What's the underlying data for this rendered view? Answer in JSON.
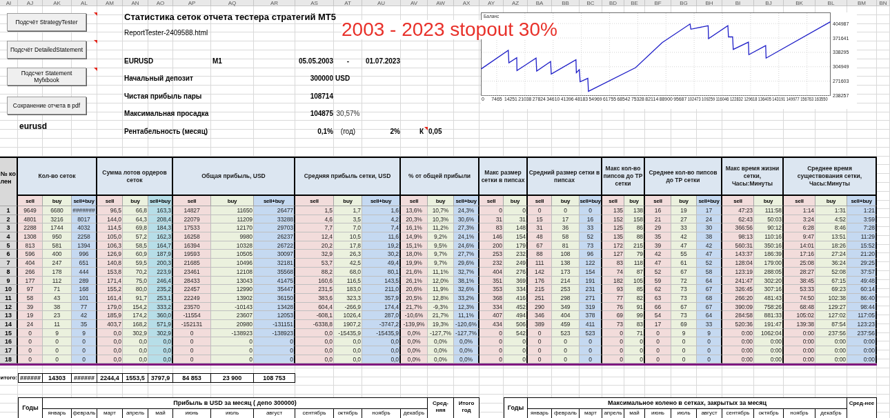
{
  "column_headers": [
    "AI",
    "AJ",
    "AK",
    "AL",
    "AM",
    "AN",
    "AO",
    "AP",
    "AQ",
    "AR",
    "AS",
    "AT",
    "AU",
    "AV",
    "AW",
    "AX",
    "AY",
    "AZ",
    "BA",
    "BB",
    "BC",
    "BD",
    "BE",
    "BF",
    "BG",
    "BH",
    "BI",
    "BJ",
    "BK",
    "BL",
    "BM",
    "BN"
  ],
  "macro_buttons": [
    {
      "label": "Подсчёт StrategyTester",
      "comment": true
    },
    {
      "label": "Подсчёт DetailedStatement",
      "comment": true
    },
    {
      "label": "Подсчет Statement Myfxbook",
      "comment": true
    },
    {
      "label": "Сохранение отчета в pdf",
      "comment": false
    }
  ],
  "sheet_label": "eurusd",
  "report": {
    "title": "Статистика сеток отчета тестера стратегий МТ5",
    "file": "ReportTester-2409588.html",
    "note": "2003 - 2023 stopout 30%"
  },
  "summary": {
    "symbol": "EURUSD",
    "timeframe": "M1",
    "date_from": "05.05.2003",
    "date_separator": "-",
    "date_to": "01.07.2023",
    "rows": [
      {
        "label": "Начальный депозит",
        "value": "300000",
        "unit": "USD"
      },
      {
        "label": "Чистая прибыль пары",
        "value": "108714"
      },
      {
        "label": "Максимальная просадка",
        "value": "104875",
        "percent": "30,57%"
      },
      {
        "label": "Рентабельность (месяц)",
        "value": "0,1%",
        "period_label": "(год)",
        "yearly_value": "2%",
        "ratio_label": "К",
        "ratio_value": "0,05",
        "ratio_comment": true
      }
    ]
  },
  "chart": {
    "chart_data": {
      "type": "line",
      "x": [
        0,
        13000,
        13300,
        17100,
        17200,
        26400,
        26700,
        33400,
        33700,
        45600,
        45800,
        47200,
        47600,
        51300,
        51600,
        74300,
        87100,
        100500,
        100900,
        109200,
        109400,
        118700,
        119000,
        121000,
        121300,
        128600,
        128800,
        136900,
        137100,
        168000
      ],
      "series": [
        {
          "name": "Баланс",
          "color": "#1f1fc8",
          "values": [
            300000,
            343000,
            314000,
            326000,
            296000,
            325000,
            295000,
            317000,
            288000,
            321000,
            291000,
            298000,
            270000,
            278000,
            248000,
            303000,
            361000,
            404000,
            392000,
            400000,
            370000,
            400000,
            374000,
            374000,
            345000,
            362000,
            333000,
            354000,
            325000,
            409000
          ]
        }
      ],
      "xlim": [
        0,
        168000
      ],
      "ylim": [
        238257,
        430000
      ],
      "xticks": [
        0,
        7465,
        14251,
        21038,
        27824,
        34610,
        41396,
        48183,
        54969,
        61755,
        68542,
        75328,
        82114,
        88900,
        95687,
        102473,
        109259,
        116046,
        122832,
        129618,
        136405,
        143191,
        149977,
        156763,
        163550
      ],
      "yticks": [
        238257,
        271603,
        304949,
        338295,
        371641,
        404987
      ],
      "grid": true
    }
  },
  "table": {
    "row_number_heading": "№ колен",
    "groups": [
      {
        "title": "Кол-во сеток",
        "columns": [
          {
            "label": "sell",
            "color": "#f2dcdb"
          },
          {
            "label": "buy",
            "color": "#ebf1de"
          },
          {
            "label": "sell+buy",
            "color": "#c5d9f1"
          }
        ]
      },
      {
        "title": "Сумма лотов ордеров сеток",
        "columns": [
          {
            "label": "sell",
            "color": "#f2dcdb"
          },
          {
            "label": "buy",
            "color": "#ebf1de"
          },
          {
            "label": "sell+buy",
            "color": "#b7dee8"
          }
        ]
      },
      {
        "title": "Общая прибыль, USD",
        "columns": [
          {
            "label": "sell",
            "color": "#f2dcdb"
          },
          {
            "label": "buy",
            "color": "#ebf1de"
          },
          {
            "label": "sell+buy",
            "color": "#c5d9f1"
          }
        ]
      },
      {
        "title": "Средняя прибыль сетки, USD",
        "columns": [
          {
            "label": "sell",
            "color": "#f2dcdb"
          },
          {
            "label": "buy",
            "color": "#ebf1de"
          },
          {
            "label": "sell+buy",
            "color": "#c5d9f1"
          }
        ]
      },
      {
        "title": "% от общей прибыли",
        "columns": [
          {
            "label": "sell",
            "color": "#f2dcdb"
          },
          {
            "label": "buy",
            "color": "#ebf1de"
          },
          {
            "label": "sell+buy",
            "color": "#c5d9f1"
          }
        ]
      },
      {
        "title": "Макс размер сетки в пипсах",
        "columns": [
          {
            "label": "sell",
            "color": "#f2dcdb"
          },
          {
            "label": "buy",
            "color": "#ebf1de"
          }
        ]
      },
      {
        "title": "Средний размер сетки в пипсах",
        "columns": [
          {
            "label": "sell",
            "color": "#f2dcdb"
          },
          {
            "label": "buy",
            "color": "#ebf1de"
          },
          {
            "label": "sell+buy",
            "color": "#c5d9f1"
          }
        ]
      },
      {
        "title": "Макс кол-во пипсов до ТР сетки",
        "columns": [
          {
            "label": "sell",
            "color": "#f2dcdb"
          },
          {
            "label": "buy",
            "color": "#ebf1de"
          }
        ]
      },
      {
        "title": "Среднее кол-во пипсов до ТР сетки",
        "columns": [
          {
            "label": "sell",
            "color": "#f2dcdb"
          },
          {
            "label": "buy",
            "color": "#ebf1de"
          },
          {
            "label": "sell+buy",
            "color": "#c5d9f1"
          }
        ]
      },
      {
        "title": "Макс время жизни сетки, Часы:Минуты",
        "columns": [
          {
            "label": "sell",
            "color": "#f2dcdb"
          },
          {
            "label": "buy",
            "color": "#ebf1de"
          }
        ]
      },
      {
        "title": "Среднее время существования сетки, Часы:Минуты",
        "columns": [
          {
            "label": "sell",
            "color": "#f2dcdb"
          },
          {
            "label": "buy",
            "color": "#ebf1de"
          },
          {
            "label": "sell+buy",
            "color": "#c5d9f1"
          }
        ]
      }
    ],
    "rows": [
      {
        "number": "1",
        "cells": [
          "9649",
          "6680",
          "#######",
          "96,5",
          "66,8",
          "163,3",
          "14827",
          "11650",
          "26477",
          "1,5",
          "1,7",
          "1,6",
          "13,6%",
          "10,7%",
          "24,3%",
          "0",
          "0",
          "0",
          "0",
          "0",
          "135",
          "138",
          "16",
          "19",
          "17",
          "47:23",
          "111:58",
          "1:14",
          "1:31",
          "1:21"
        ]
      },
      {
        "number": "2",
        "cells": [
          "4801",
          "3216",
          "8017",
          "144,0",
          "64,3",
          "208,4",
          "22079",
          "11209",
          "33288",
          "4,6",
          "3,5",
          "4,2",
          "20,3%",
          "10,3%",
          "30,6%",
          "31",
          "31",
          "15",
          "17",
          "16",
          "152",
          "158",
          "21",
          "27",
          "24",
          "62:43",
          "50:03",
          "3:24",
          "4:52",
          "3:59"
        ]
      },
      {
        "number": "3",
        "cells": [
          "2288",
          "1744",
          "4032",
          "114,5",
          "69,8",
          "184,3",
          "17533",
          "12170",
          "29703",
          "7,7",
          "7,0",
          "7,4",
          "16,1%",
          "11,2%",
          "27,3%",
          "83",
          "148",
          "31",
          "36",
          "33",
          "125",
          "86",
          "29",
          "33",
          "30",
          "366:56",
          "90:12",
          "6:28",
          "8:46",
          "7:28"
        ]
      },
      {
        "number": "4",
        "cells": [
          "1308",
          "950",
          "2258",
          "105,0",
          "57,2",
          "162,3",
          "16258",
          "9980",
          "26237",
          "12,4",
          "10,5",
          "11,6",
          "14,9%",
          "9,2%",
          "24,1%",
          "146",
          "154",
          "48",
          "58",
          "52",
          "135",
          "88",
          "35",
          "42",
          "38",
          "98:13",
          "110:16",
          "9:47",
          "13:51",
          "11:29"
        ]
      },
      {
        "number": "5",
        "cells": [
          "813",
          "581",
          "1394",
          "106,3",
          "58,5",
          "164,7",
          "16394",
          "10328",
          "26722",
          "20,2",
          "17,8",
          "19,2",
          "15,1%",
          "9,5%",
          "24,6%",
          "200",
          "179",
          "67",
          "81",
          "73",
          "172",
          "215",
          "39",
          "47",
          "42",
          "560:31",
          "350:16",
          "14:01",
          "18:26",
          "15:52"
        ]
      },
      {
        "number": "6",
        "cells": [
          "596",
          "400",
          "996",
          "126,9",
          "60,9",
          "187,9",
          "19593",
          "10505",
          "30097",
          "32,9",
          "26,3",
          "30,2",
          "18,0%",
          "9,7%",
          "27,7%",
          "253",
          "232",
          "88",
          "108",
          "96",
          "127",
          "79",
          "42",
          "55",
          "47",
          "143:37",
          "186:39",
          "17:16",
          "27:24",
          "21:20"
        ]
      },
      {
        "number": "7",
        "cells": [
          "404",
          "247",
          "651",
          "140,8",
          "59,5",
          "200,3",
          "21685",
          "10496",
          "32181",
          "53,7",
          "42,5",
          "49,4",
          "19,9%",
          "9,7%",
          "29,6%",
          "232",
          "249",
          "111",
          "138",
          "122",
          "83",
          "118",
          "47",
          "61",
          "52",
          "128:04",
          "179:00",
          "25:08",
          "36:24",
          "29:25"
        ]
      },
      {
        "number": "8",
        "cells": [
          "266",
          "178",
          "444",
          "153,8",
          "70,2",
          "223,9",
          "23461",
          "12108",
          "35568",
          "88,2",
          "68,0",
          "80,1",
          "21,6%",
          "11,1%",
          "32,7%",
          "404",
          "276",
          "142",
          "173",
          "154",
          "74",
          "87",
          "52",
          "67",
          "58",
          "123:19",
          "288:05",
          "28:27",
          "52:08",
          "37:57"
        ]
      },
      {
        "number": "9",
        "cells": [
          "177",
          "112",
          "289",
          "171,4",
          "75,0",
          "246,4",
          "28433",
          "13043",
          "41475",
          "160,6",
          "116,5",
          "143,5",
          "26,1%",
          "12,0%",
          "38,1%",
          "351",
          "369",
          "176",
          "214",
          "191",
          "182",
          "105",
          "59",
          "72",
          "64",
          "241:47",
          "302:20",
          "38:45",
          "67:15",
          "49:48"
        ]
      },
      {
        "number": "10",
        "cells": [
          "97",
          "71",
          "168",
          "155,2",
          "80,0",
          "235,2",
          "22457",
          "12990",
          "35447",
          "231,5",
          "183,0",
          "211,0",
          "20,6%",
          "11,9%",
          "32,6%",
          "353",
          "334",
          "215",
          "253",
          "231",
          "93",
          "85",
          "62",
          "73",
          "67",
          "326:45",
          "307:16",
          "53:33",
          "69:23",
          "60:14"
        ]
      },
      {
        "number": "11",
        "cells": [
          "58",
          "43",
          "101",
          "161,4",
          "91,7",
          "253,1",
          "22249",
          "13902",
          "36150",
          "383,6",
          "323,3",
          "357,9",
          "20,5%",
          "12,8%",
          "33,2%",
          "368",
          "416",
          "251",
          "298",
          "271",
          "77",
          "82",
          "63",
          "73",
          "68",
          "266:20",
          "481:43",
          "74:50",
          "102:38",
          "86:40"
        ]
      },
      {
        "number": "12",
        "cells": [
          "39",
          "38",
          "77",
          "179,0",
          "154,2",
          "333,2",
          "23570",
          "-10143",
          "13428",
          "604,4",
          "-266,9",
          "174,4",
          "21,7%",
          "-9,3%",
          "12,3%",
          "334",
          "452",
          "290",
          "349",
          "319",
          "76",
          "91",
          "66",
          "67",
          "67",
          "390:09",
          "758:26",
          "68:48",
          "129:27",
          "98:44"
        ]
      },
      {
        "number": "13",
        "cells": [
          "19",
          "23",
          "42",
          "185,9",
          "174,2",
          "360,0",
          "-11554",
          "23607",
          "12053",
          "-608,1",
          "1026,4",
          "287,0",
          "-10,6%",
          "21,7%",
          "11,1%",
          "407",
          "494",
          "346",
          "404",
          "378",
          "69",
          "99",
          "54",
          "73",
          "64",
          "284:58",
          "881:33",
          "105:02",
          "127:02",
          "117:05"
        ]
      },
      {
        "number": "14",
        "cells": [
          "24",
          "11",
          "35",
          "403,7",
          "168,2",
          "571,9",
          "-152131",
          "20980",
          "-131151",
          "-6338,8",
          "1907,2",
          "-3747,2",
          "-139,9%",
          "19,3%",
          "-120,6%",
          "434",
          "506",
          "389",
          "459",
          "411",
          "73",
          "83",
          "17",
          "69",
          "33",
          "520:36",
          "191:47",
          "139:38",
          "87:54",
          "123:23"
        ]
      },
      {
        "number": "15",
        "cells": [
          "0",
          "9",
          "9",
          "0,0",
          "302,9",
          "302,9",
          "0",
          "-138923",
          "-138923",
          "0,0",
          "-15435,9",
          "-15435,9",
          "0,0%",
          "-127,7%",
          "-127,7%",
          "0",
          "542",
          "0",
          "523",
          "523",
          "0",
          "71",
          "0",
          "9",
          "9",
          "0:00",
          "1062:04",
          "0:00",
          "237:56",
          "237:56"
        ]
      },
      {
        "number": "16",
        "cells": [
          "0",
          "0",
          "0",
          "0,0",
          "0,0",
          "0,0",
          "0",
          "0",
          "0",
          "0,0",
          "0,0",
          "0,0",
          "0,0%",
          "0,0%",
          "0,0%",
          "0",
          "0",
          "0",
          "0",
          "0",
          "0",
          "0",
          "0",
          "0",
          "0",
          "0:00",
          "0:00",
          "0:00",
          "0:00",
          "0:00"
        ]
      },
      {
        "number": "17",
        "cells": [
          "0",
          "0",
          "0",
          "0,0",
          "0,0",
          "0,0",
          "0",
          "0",
          "0",
          "0,0",
          "0,0",
          "0,0",
          "0,0%",
          "0,0%",
          "0,0%",
          "0",
          "0",
          "0",
          "0",
          "0",
          "0",
          "0",
          "0",
          "0",
          "0",
          "0:00",
          "0:00",
          "0:00",
          "0:00",
          "0:00"
        ]
      },
      {
        "number": "18",
        "cells": [
          "0",
          "0",
          "0",
          "0,0",
          "0,0",
          "0,0",
          "0",
          "0",
          "0",
          "0,0",
          "0,0",
          "0,0",
          "0,0%",
          "0,0%",
          "0,0%",
          "0",
          "0",
          "0",
          "0",
          "0",
          "0",
          "0",
          "0",
          "0",
          "0",
          "0:00",
          "0:00",
          "0:00",
          "0:00",
          "0:00"
        ]
      }
    ]
  },
  "totals": {
    "label": "итого:",
    "cells": [
      "######",
      "14303",
      "######",
      "2244,4",
      "1553,5",
      "3797,9",
      "84 853",
      "23 900",
      "108 753"
    ]
  },
  "monthly_tables": [
    {
      "years_label": "Годы",
      "title": "Прибыль в USD за месяц ( депо 300000)",
      "months": [
        "январь",
        "февраль",
        "март",
        "апрель",
        "май",
        "июнь",
        "июль",
        "август",
        "сентябрь",
        "октябрь",
        "ноябрь",
        "декабрь"
      ],
      "extra_columns": [
        "Сред-няя",
        "Итого год"
      ]
    },
    {
      "years_label": "Годы",
      "title": "Максимальное колено в сетках, закрытых за месяц",
      "months": [
        "январь",
        "февраль",
        "март",
        "апрель",
        "май",
        "июнь",
        "июль",
        "август",
        "сентябрь",
        "октябрь",
        "ноябрь",
        "декабрь"
      ],
      "extra_columns": [
        "Сред-нее"
      ]
    }
  ]
}
